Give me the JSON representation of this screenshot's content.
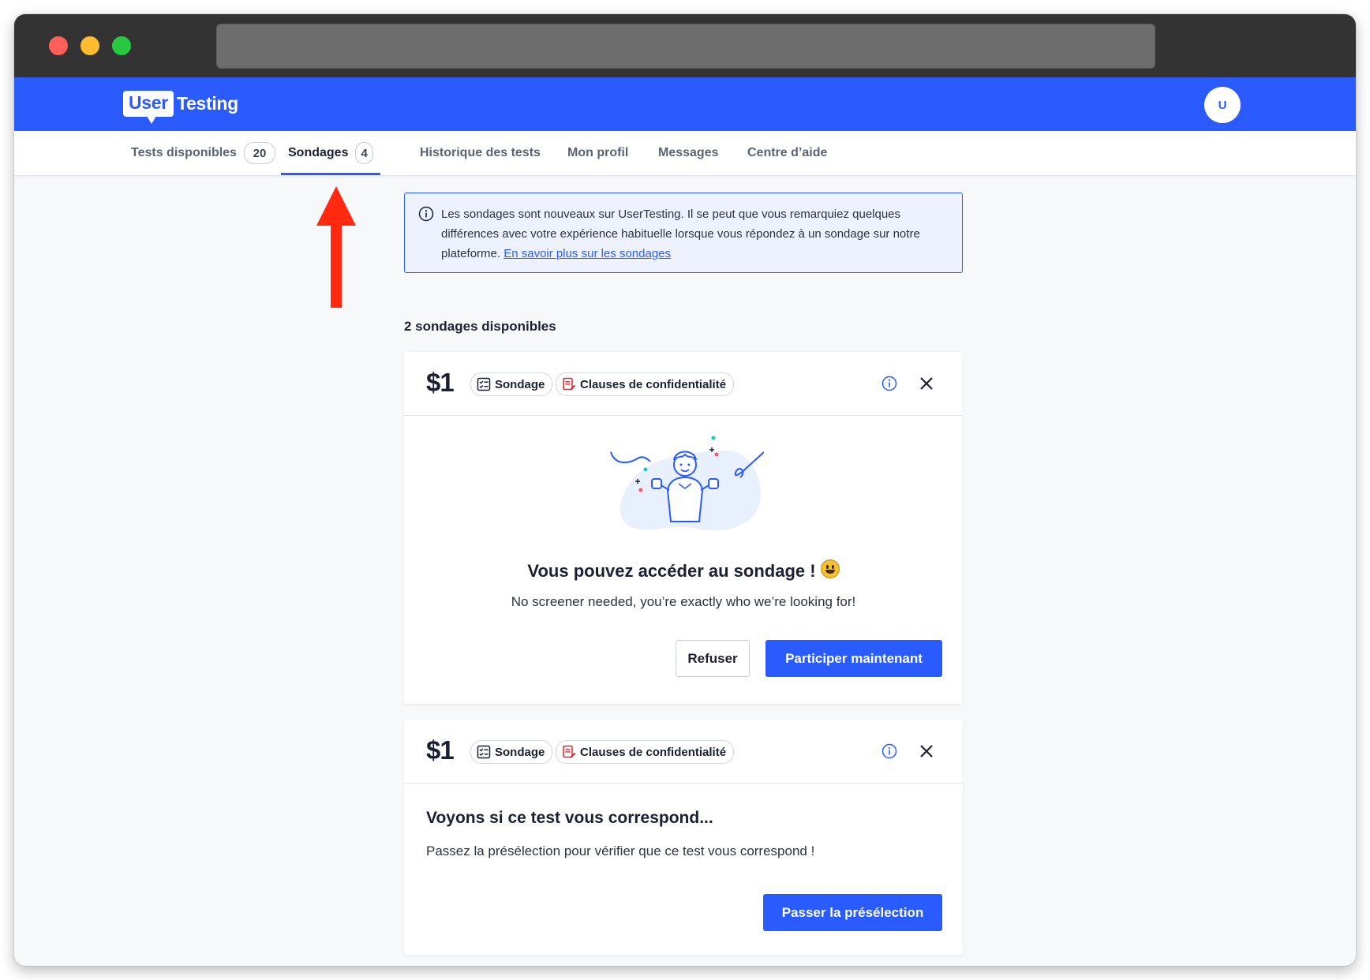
{
  "brand": {
    "logo_user": "User",
    "logo_testing": "Testing",
    "avatar_initial": "U",
    "primary_color": "#2a5bff"
  },
  "nav": {
    "tabs": [
      {
        "label": "Tests disponibles",
        "count": "20"
      },
      {
        "label": "Sondages",
        "count": "4"
      },
      {
        "label": "Historique des tests"
      },
      {
        "label": "Mon profil"
      },
      {
        "label": "Messages"
      },
      {
        "label": "Centre d’aide"
      }
    ],
    "active_tab": "Sondages"
  },
  "notice": {
    "text": "Les sondages sont nouveaux sur UserTesting. Il se peut que vous remarquiez quelques différences avec votre expérience habituelle lorsque vous répondez à un sondage sur notre plateforme. ",
    "link": "En savoir plus sur les sondages"
  },
  "section_title": "2 sondages disponibles",
  "cards": [
    {
      "price": "$1",
      "chip_survey": "Sondage",
      "chip_privacy": "Clauses de confidentialité",
      "title": "Vous pouvez accéder au sondage !",
      "subtitle": "No screener needed, you’re exactly who we’re looking for!",
      "decline_label": "Refuser",
      "participate_label": "Participer maintenant"
    },
    {
      "price": "$1",
      "chip_survey": "Sondage",
      "chip_privacy": "Clauses de confidentialité",
      "title": "Voyons si ce test vous correspond...",
      "subtitle": "Passez la présélection pour vérifier que ce test vous correspond !",
      "screener_label": "Passer la présélection"
    }
  ]
}
